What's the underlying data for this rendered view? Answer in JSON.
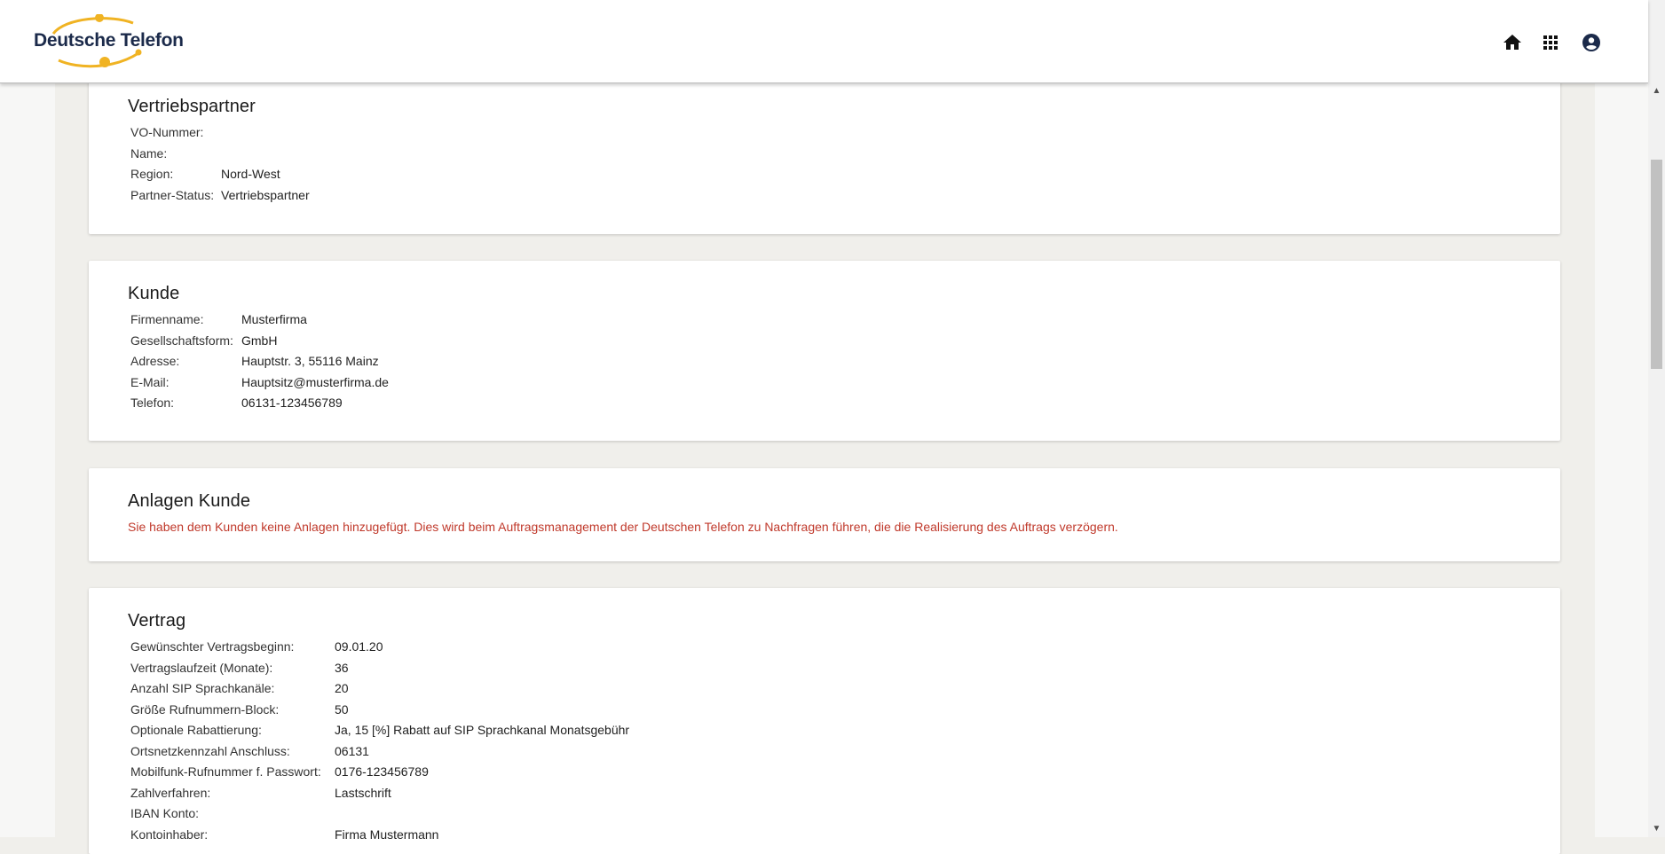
{
  "brand": {
    "logo_text": "Deutsche Telefon",
    "accent_color": "#f0b323"
  },
  "header": {
    "icons": [
      "home-icon",
      "apps-grid-icon",
      "account-icon"
    ]
  },
  "vertriebspartner": {
    "title": "Vertriebspartner",
    "rows": [
      {
        "label": "VO-Nummer:",
        "value": ""
      },
      {
        "label": "Name:",
        "value": ""
      },
      {
        "label": "Region:",
        "value": "Nord-West"
      },
      {
        "label": "Partner-Status:",
        "value": "Vertriebspartner"
      }
    ]
  },
  "kunde": {
    "title": "Kunde",
    "rows": [
      {
        "label": "Firmenname:",
        "value": "Musterfirma"
      },
      {
        "label": "Gesellschaftsform:",
        "value": "GmbH"
      },
      {
        "label": "Adresse:",
        "value": "Hauptstr. 3, 55116 Mainz"
      },
      {
        "label": "E-Mail:",
        "value": "Hauptsitz@musterfirma.de"
      },
      {
        "label": "Telefon:",
        "value": "06131-123456789"
      }
    ]
  },
  "anlagen": {
    "title": "Anlagen Kunde",
    "notice": "Sie haben dem Kunden keine Anlagen hinzugefügt. Dies wird beim Auftragsmanagement der Deutschen Telefon zu Nachfragen führen, die die Realisierung des Auftrags verzögern.",
    "notice_color": "#c0392b"
  },
  "vertrag": {
    "title": "Vertrag",
    "rows": [
      {
        "label": "Gewünschter Vertragsbeginn:",
        "value": "09.01.20"
      },
      {
        "label": "Vertragslaufzeit (Monate):",
        "value": "36"
      },
      {
        "label": "Anzahl SIP Sprachkanäle:",
        "value": "20"
      },
      {
        "label": "Größe Rufnummern-Block:",
        "value": "50"
      },
      {
        "label": "Optionale Rabattierung:",
        "value": "Ja, 15 [%] Rabatt auf SIP Sprachkanal Monatsgebühr"
      },
      {
        "label": "Ortsnetzkennzahl Anschluss:",
        "value": "06131"
      },
      {
        "label": "Mobilfunk-Rufnummer f. Passwort:",
        "value": "0176-123456789"
      },
      {
        "label": "Zahlverfahren:",
        "value": "Lastschrift"
      },
      {
        "label": "IBAN Konto:",
        "value": ""
      },
      {
        "label": "Kontoinhaber:",
        "value": "Firma Mustermann"
      }
    ]
  }
}
